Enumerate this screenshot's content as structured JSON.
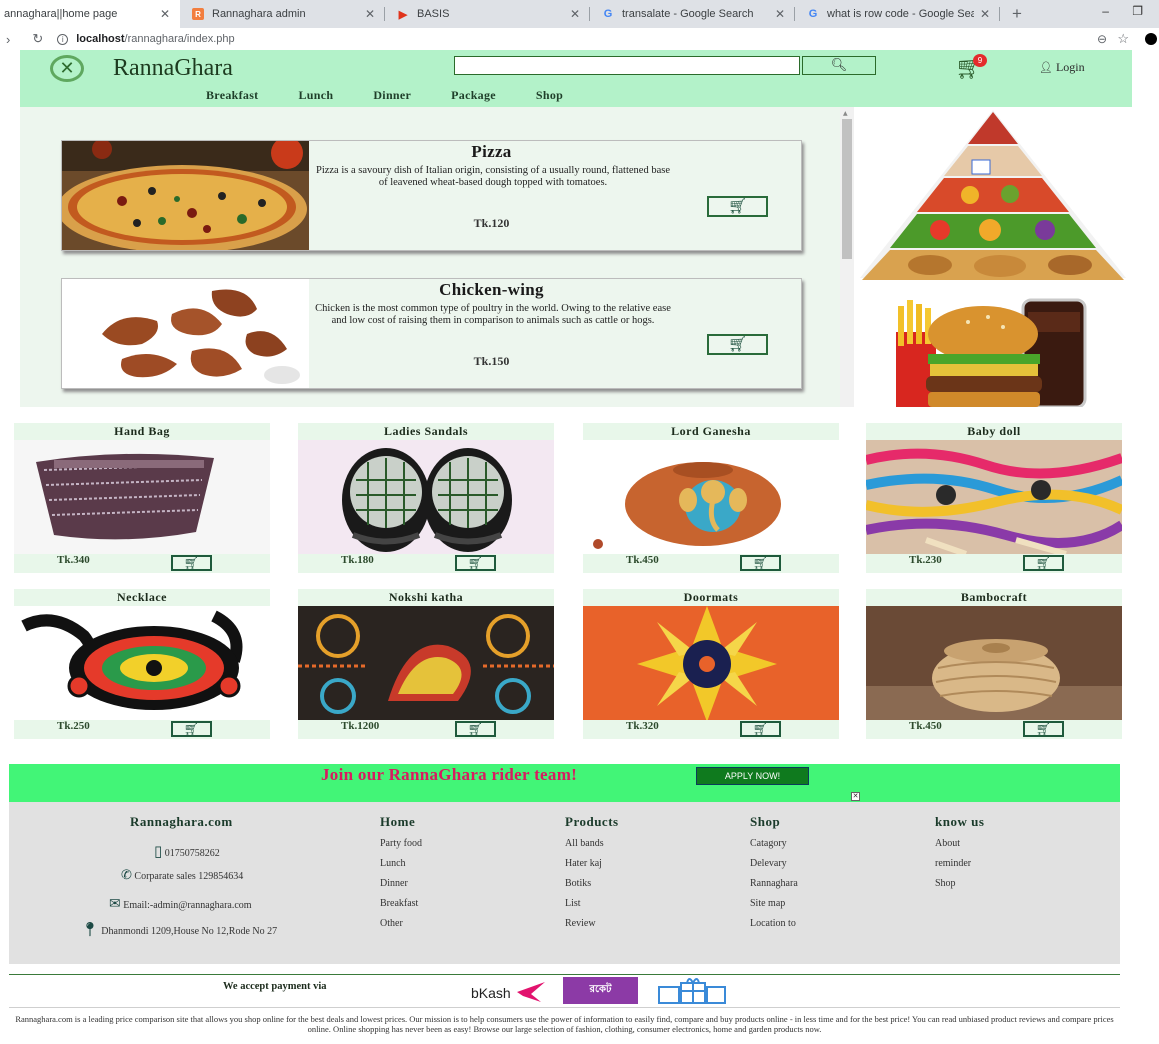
{
  "browser": {
    "tabs": [
      {
        "title": "annaghara||home page",
        "icon": "page-icon"
      },
      {
        "title": "Rannaghara admin",
        "icon": "admin-icon"
      },
      {
        "title": "BASIS",
        "icon": "basis-icon"
      },
      {
        "title": "transalate - Google Search",
        "icon": "google-icon"
      },
      {
        "title": "what is row code - Google Sear",
        "icon": "google-icon"
      }
    ],
    "url_host": "localhost",
    "url_path": "/rannaghara/index.php"
  },
  "header": {
    "site_name": "RannaGhara",
    "search_placeholder": "",
    "cart_count": "9",
    "login_label": "Login",
    "nav": [
      "Breakfast",
      "Lunch",
      "Dinner",
      "Package",
      "Shop"
    ]
  },
  "featured": [
    {
      "title": "Pizza",
      "description": "Pizza is a savoury dish of Italian origin, consisting of a usually round, flattened base of leavened wheat-based dough topped with tomatoes.",
      "price": "Tk.120"
    },
    {
      "title": "Chicken-wing",
      "description": "Chicken is the most common type of poultry in the world. Owing to the relative ease and low cost of raising them in comparison to animals such as cattle or hogs.",
      "price": "Tk.150"
    }
  ],
  "products": [
    {
      "name": "Hand Bag",
      "price": "Tk.340"
    },
    {
      "name": "Ladies Sandals",
      "price": "Tk.180"
    },
    {
      "name": "Lord Ganesha",
      "price": "Tk.450"
    },
    {
      "name": "Baby doll",
      "price": "Tk.230"
    },
    {
      "name": "Necklace",
      "price": "Tk.250"
    },
    {
      "name": "Nokshi katha",
      "price": "Tk.1200"
    },
    {
      "name": "Doormats",
      "price": "Tk.320"
    },
    {
      "name": "Bambocraft",
      "price": "Tk.450"
    }
  ],
  "rider": {
    "text": "Join our RannaGhara rider team!",
    "button": "APPLY NOW!"
  },
  "footer": {
    "brand": "Rannaghara.com",
    "phone": "01750758262",
    "corporate": "Corparate sales 129854634",
    "email": "Email:-admin@rannaghara.com",
    "address": "Dhanmondi 1209,House No 12,Rode No 27",
    "columns": [
      {
        "heading": "Home",
        "links": [
          "Party food",
          "Lunch",
          "Dinner",
          "Breakfast",
          "Other"
        ]
      },
      {
        "heading": "Products",
        "links": [
          "All bands",
          "Hater kaj",
          "Botiks",
          "List",
          "Review"
        ]
      },
      {
        "heading": "Shop",
        "links": [
          "Catagory",
          "Delevary",
          "Rannaghara",
          "Site map",
          "Location to"
        ]
      },
      {
        "heading": "know us",
        "links": [
          "About",
          "reminder",
          "Shop"
        ]
      }
    ]
  },
  "payment": {
    "label": "We accept payment via",
    "bkash": "bKash",
    "rocket": "রকেট"
  },
  "about": "Rannaghara.com is a leading price comparison site that allows you shop online for the best deals and lowest prices. Our mission is to help consumers use the power of information to easily find, compare and buy products online - in less time and for the best price! You can read unbiased product reviews and compare prices online. Online shopping has never been as easy! Browse our large selection of fashion, clothing, consumer electronics, home and garden products now."
}
